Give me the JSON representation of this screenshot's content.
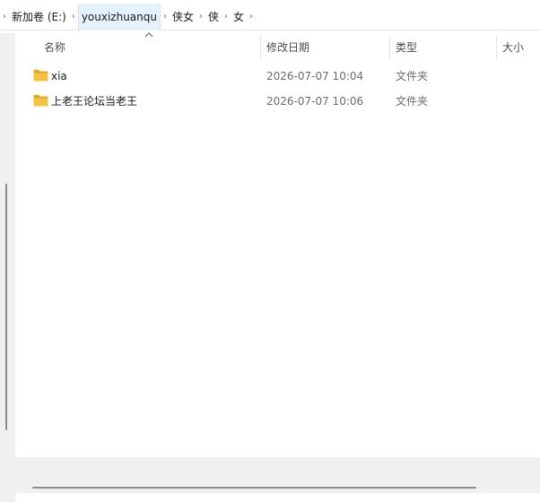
{
  "breadcrumb": {
    "items": [
      "新加卷 (E:)",
      "youxizhuanqu",
      "侠女",
      "侠",
      "女"
    ]
  },
  "columns": {
    "name": "名称",
    "date": "修改日期",
    "type": "类型",
    "size": "大小"
  },
  "files": [
    {
      "name": "xia",
      "date": "2026-07-07 10:04",
      "type": "文件夹",
      "icon": "folder-icon"
    },
    {
      "name": "上老王论坛当老王",
      "date": "2026-07-07 10:06",
      "type": "文件夹",
      "icon": "folder-icon"
    }
  ],
  "colors": {
    "folder": "#f5c33b",
    "folder_dark": "#e0a820",
    "selected_crumb_bg": "#e5f1fb"
  }
}
